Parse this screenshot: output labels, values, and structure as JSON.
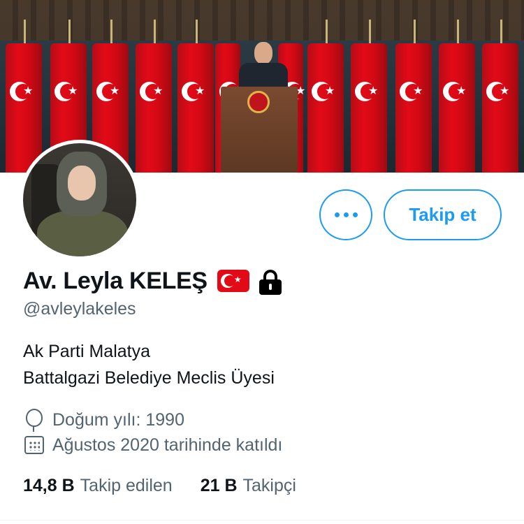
{
  "profile": {
    "display_name": "Av. Leyla KELEŞ",
    "handle": "@avleylakeles",
    "bio_lines": [
      "Ak Parti Malatya",
      "Battalgazi Belediye Meclis Üyesi"
    ],
    "birth": "Doğum yılı: 1990",
    "joined": "Ağustos 2020 tarihinde katıldı",
    "badges": [
      "turkey-flag-icon",
      "lock-icon"
    ]
  },
  "actions": {
    "more_icon": "more-dots-icon",
    "follow_label": "Takip et"
  },
  "stats": {
    "following_count": "14,8 B",
    "following_label": "Takip edilen",
    "followers_count": "21 B",
    "followers_label": "Takipçi"
  },
  "colors": {
    "accent": "#1d9bf0",
    "text_primary": "#0f1419",
    "text_secondary": "#536471",
    "flag_red": "#e30a17"
  }
}
